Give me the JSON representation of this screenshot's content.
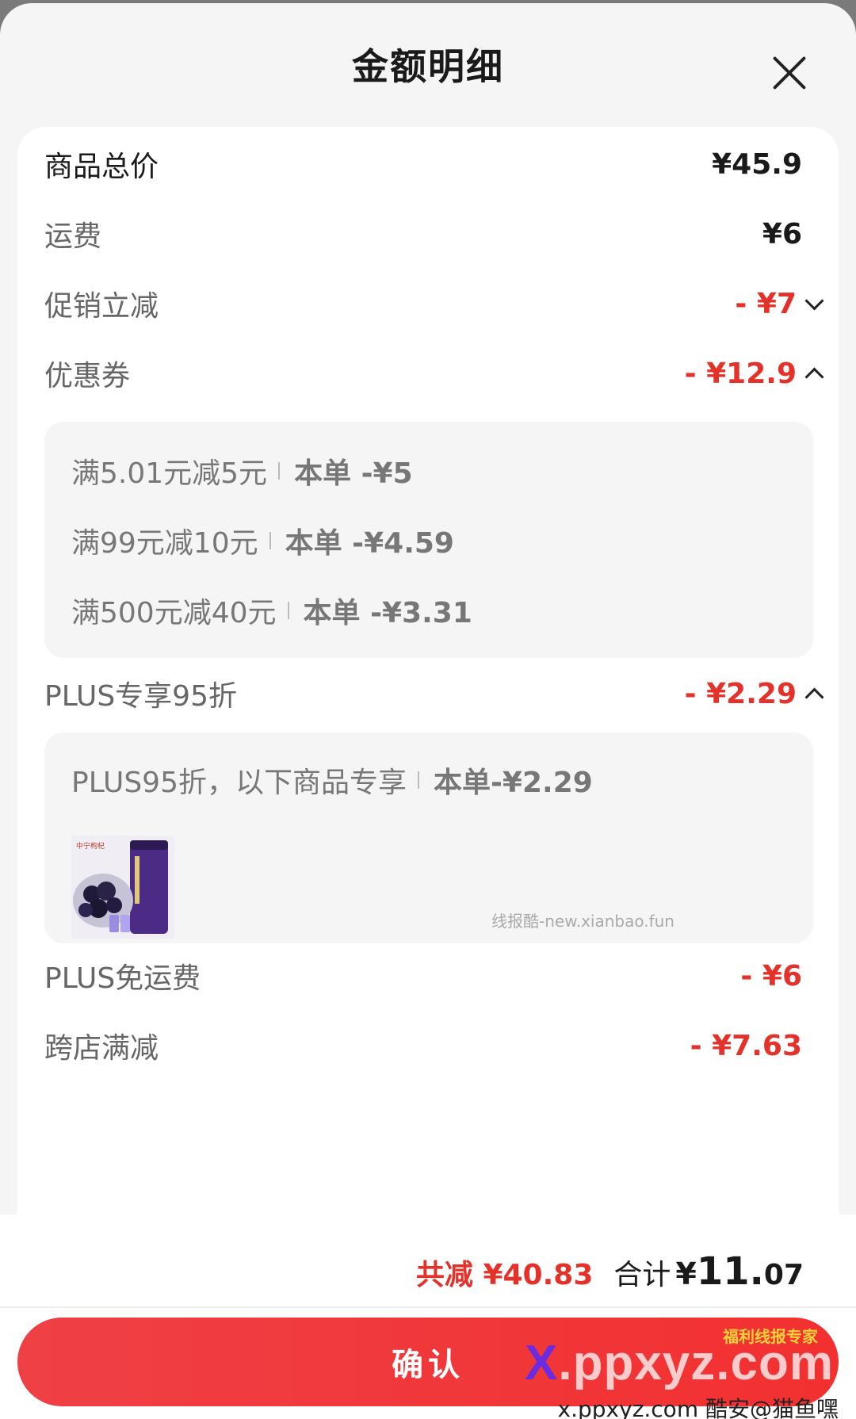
{
  "sheet": {
    "title": "金额明细"
  },
  "rows": {
    "goods_total": {
      "label": "商品总价",
      "value": "¥45.9"
    },
    "shipping": {
      "label": "运费",
      "value": "¥6"
    },
    "promo": {
      "label": "促销立减",
      "value": "- ¥7"
    },
    "coupon": {
      "label": "优惠券",
      "value": "- ¥12.9"
    },
    "plus_discount": {
      "label": "PLUS专享95折",
      "value": "- ¥2.29"
    },
    "plus_free_ship": {
      "label": "PLUS免运费",
      "value": "- ¥6"
    },
    "cross_store": {
      "label": "跨店满减",
      "value": "- ¥7.63"
    }
  },
  "coupons": [
    {
      "rule": "满5.01元减5元",
      "applied": "本单 -¥5"
    },
    {
      "rule": "满99元减10元",
      "applied": "本单 -¥4.59"
    },
    {
      "rule": "满500元减40元",
      "applied": "本单 -¥3.31"
    }
  ],
  "plus_detail": {
    "rule": "PLUS95折，以下商品专享",
    "applied": "本单-¥2.29",
    "watermark": "线报酷-new.xianbao.fun"
  },
  "footer": {
    "saved": "共减 ¥40.83",
    "total_label": "合计",
    "total_yen": "¥",
    "total_int": "11.",
    "total_dec": "07",
    "confirm_label": "确认",
    "brand_x": "X",
    "brand_rest": ".ppxyz.com",
    "badge": "福利线报专家",
    "credit": "x.ppxyz.com 酷安@猫鱼嘿"
  },
  "colors": {
    "accent": "#e4322b",
    "button": "#f23030",
    "sheet_bg": "#f5f5f5"
  },
  "icons": {
    "close": "close-icon",
    "collapse": "chevron-down-icon",
    "expand": "chevron-up-icon"
  }
}
